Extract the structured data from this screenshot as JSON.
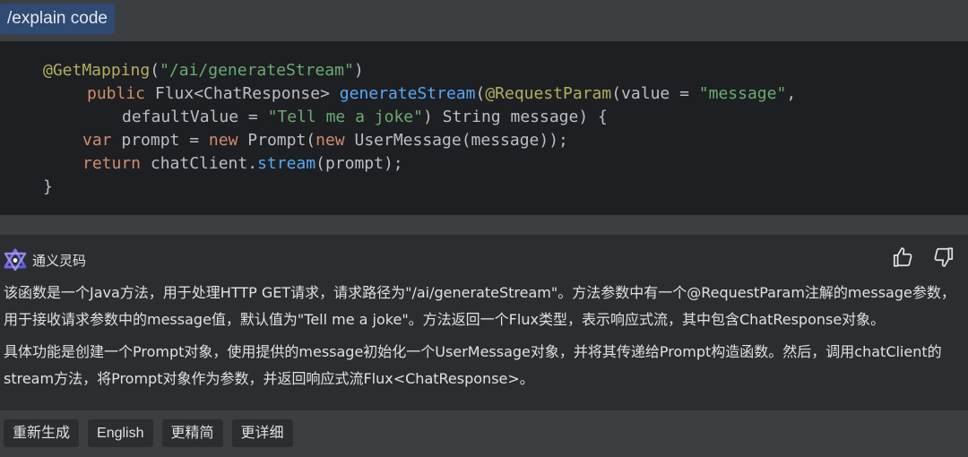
{
  "prompt": {
    "command": "/explain code"
  },
  "code": {
    "lines": [
      [
        {
          "t": "@GetMapping",
          "c": "ann"
        },
        {
          "t": "(",
          "c": "txt"
        },
        {
          "t": "\"/ai/generateStream\"",
          "c": "str"
        },
        {
          "t": ")",
          "c": "txt"
        }
      ],
      [
        {
          "t": "public ",
          "c": "kw"
        },
        {
          "t": "Flux<ChatResponse> ",
          "c": "txt"
        },
        {
          "t": "generateStream",
          "c": "fn"
        },
        {
          "t": "(",
          "c": "txt"
        },
        {
          "t": "@RequestParam",
          "c": "ann"
        },
        {
          "t": "(value = ",
          "c": "txt"
        },
        {
          "t": "\"message\"",
          "c": "str"
        },
        {
          "t": ",",
          "c": "txt"
        }
      ],
      [
        {
          "t": "defaultValue = ",
          "c": "txt"
        },
        {
          "t": "\"Tell me a joke\"",
          "c": "str"
        },
        {
          "t": ") String message) {",
          "c": "txt"
        }
      ],
      [
        {
          "t": "var ",
          "c": "kw"
        },
        {
          "t": "prompt = ",
          "c": "txt"
        },
        {
          "t": "new ",
          "c": "kw"
        },
        {
          "t": "Prompt(",
          "c": "txt"
        },
        {
          "t": "new ",
          "c": "kw"
        },
        {
          "t": "UserMessage(message));",
          "c": "txt"
        }
      ],
      [
        {
          "t": "return ",
          "c": "kw"
        },
        {
          "t": "chatClient.",
          "c": "txt"
        },
        {
          "t": "stream",
          "c": "fn"
        },
        {
          "t": "(prompt);",
          "c": "txt"
        }
      ],
      [
        {
          "t": "}",
          "c": "txt"
        }
      ]
    ]
  },
  "assistant": {
    "name": "通义灵码",
    "logo_icon": "tongyi-lingma-logo",
    "feedback": {
      "like_icon": "thumbs-up-icon",
      "dislike_icon": "thumbs-down-icon"
    },
    "paragraphs": [
      "该函数是一个Java方法，用于处理HTTP GET请求，请求路径为\"/ai/generateStream\"。方法参数中有一个@RequestParam注解的message参数，用于接收请求参数中的message值，默认值为\"Tell me a joke\"。方法返回一个Flux类型，表示响应式流，其中包含ChatResponse对象。",
      "具体功能是创建一个Prompt对象，使用提供的message初始化一个UserMessage对象，并将其传递给Prompt构造函数。然后，调用chatClient的stream方法，将Prompt对象作为参数，并返回响应式流Flux<ChatResponse>。"
    ]
  },
  "actions": {
    "regenerate": "重新生成",
    "english": "English",
    "more_concise": "更精简",
    "more_detailed": "更详细"
  },
  "colors": {
    "code_bg": "#1e1f22",
    "panel_bg": "#2b2d30",
    "annotation": "#b3ae60",
    "string": "#6aab73",
    "keyword": "#cf8e6d",
    "function": "#56a8f5"
  }
}
